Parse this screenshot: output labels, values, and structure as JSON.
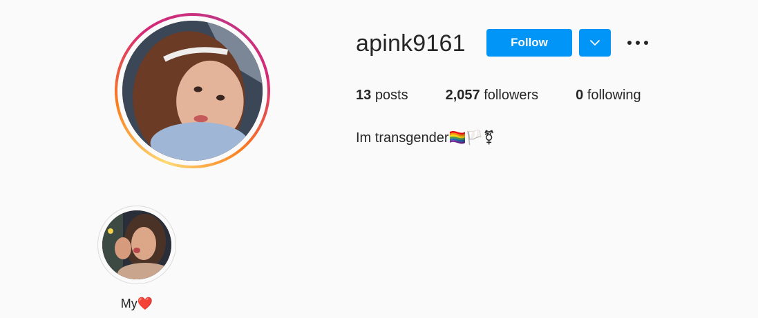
{
  "profile": {
    "username": "apink9161",
    "follow_label": "Follow",
    "avatar_icon": "profile-photo",
    "ring_colors": [
      "#feda75",
      "#fa7e1e",
      "#d62976",
      "#c13584"
    ]
  },
  "stats": {
    "posts_count": "13",
    "posts_label": "posts",
    "followers_count": "2,057",
    "followers_label": "followers",
    "following_count": "0",
    "following_label": "following"
  },
  "bio": {
    "text": "Im transgender🏳️‍🌈🏳️⚧"
  },
  "highlights": [
    {
      "label": "My❤️"
    }
  ],
  "colors": {
    "accent": "#0095f6",
    "background": "#fafafa",
    "text": "#262626"
  }
}
